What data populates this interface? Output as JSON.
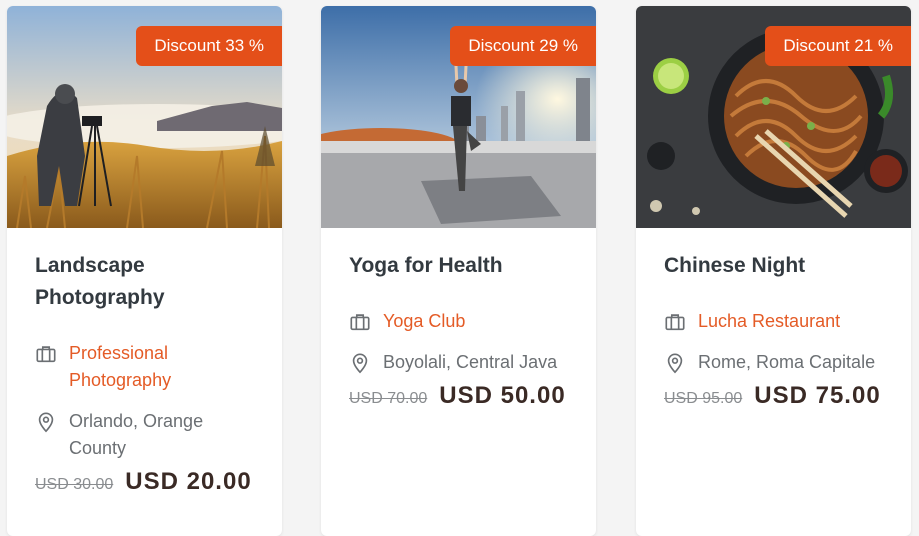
{
  "events": [
    {
      "discount": "Discount 33 %",
      "title": "Landscape Photography",
      "organizer": "Professional Photography",
      "location": "Orlando, Orange County",
      "old_price": "USD 30.00",
      "price": "USD 20.00",
      "image_icon": "landscape-photographer-image"
    },
    {
      "discount": "Discount 29 %",
      "title": "Yoga for Health",
      "organizer": "Yoga Club",
      "location": "Boyolali, Central Java",
      "old_price": "USD 70.00",
      "price": "USD 50.00",
      "image_icon": "rooftop-yoga-image"
    },
    {
      "discount": "Discount 21 %",
      "title": "Chinese Night",
      "organizer": "Lucha Restaurant",
      "location": "Rome, Roma Capitale",
      "old_price": "USD 95.00",
      "price": "USD 75.00",
      "image_icon": "noodle-bowl-image"
    }
  ],
  "icons": {
    "organizer": "briefcase-icon",
    "location": "map-pin-icon"
  },
  "colors": {
    "badge": "#e44f19",
    "organizer_text": "#e45b26",
    "price_text": "#3a2a25"
  }
}
